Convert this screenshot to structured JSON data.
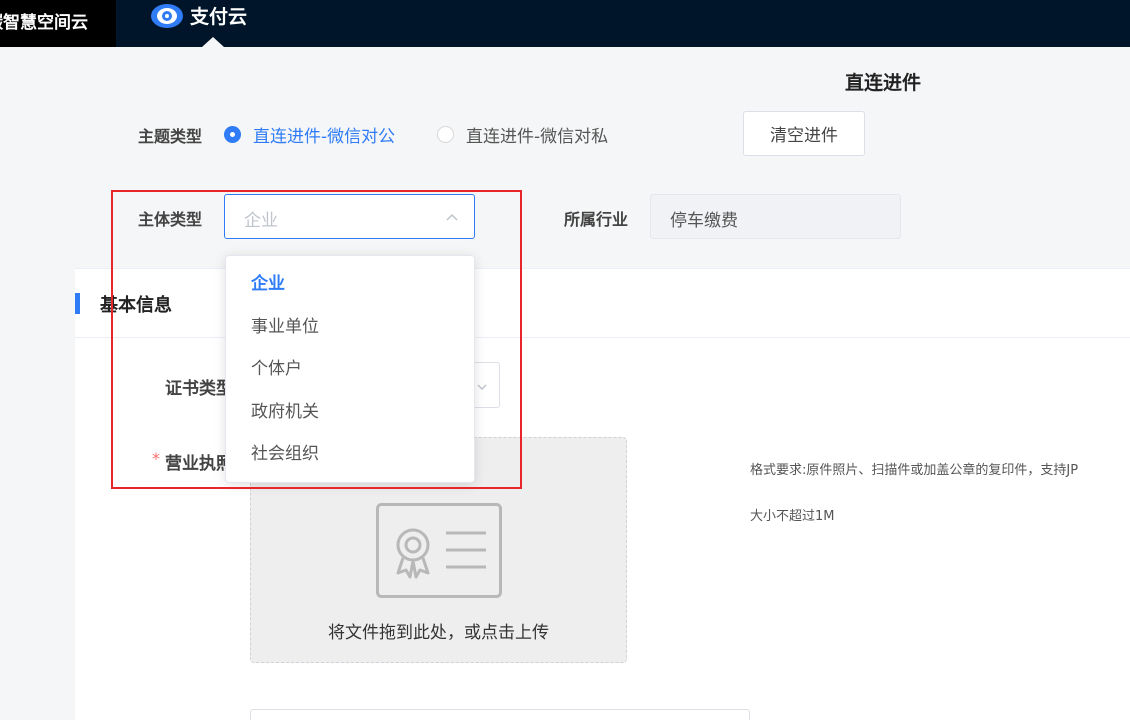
{
  "header": {
    "brand": "碳智慧空间云",
    "nav_item": "支付云"
  },
  "page_title": "直连进件",
  "subject_type": {
    "label": "主题类型",
    "options": [
      {
        "label": "直连进件-微信对公",
        "checked": true
      },
      {
        "label": "直连进件-微信对私",
        "checked": false
      }
    ],
    "clear_button": "清空进件"
  },
  "entity_type": {
    "label": "主体类型",
    "select_value": "企业",
    "dropdown_options": [
      "企业",
      "事业单位",
      "个体户",
      "政府机关",
      "社会组织"
    ],
    "selected_index": 0
  },
  "industry": {
    "label": "所属行业",
    "value": "停车缴费"
  },
  "basic_info": {
    "title": "基本信息",
    "cert_type_label": "证书类型",
    "license_label": "营业执照",
    "required_mark": "*",
    "upload_text": "将文件拖到此处，或点击上传",
    "hint_format": "格式要求:原件照片、扫描件或加盖公章的复印件，支持JP",
    "hint_size": "大小不超过1M"
  },
  "colors": {
    "primary": "#2f7cf6",
    "topbar": "#001529",
    "annotation": "#e8262a"
  }
}
